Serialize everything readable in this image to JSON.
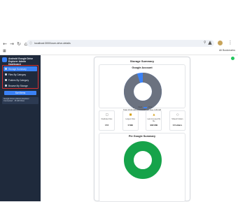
{
  "browser": {
    "url": "localhost:3000/user-drive-details",
    "all_bookmarks": "All Bookmarks",
    "icons": {
      "back": "arrow-left-icon",
      "forward": "arrow-right-icon",
      "reload": "reload-icon",
      "home": "home-icon",
      "site_info": "site-info-icon",
      "bookmark": "star-icon",
      "extensions": "puzzle-icon",
      "menu": "kebab-menu-icon",
      "apps": "apps-grid-icon"
    }
  },
  "sidebar": {
    "brand": "Android Google Drive Explorer Admin Dashboard",
    "items": [
      {
        "label": "Storage Summary",
        "active": true
      },
      {
        "label": "Files By Category",
        "active": false
      },
      {
        "label": "Folders By Category",
        "active": false
      },
      {
        "label": "Browse My Storage",
        "active": false
      }
    ],
    "button": "Sort Items",
    "note": [
      "Google Drive (Admin) Explorer",
      "Connected · 15 GB Drive"
    ]
  },
  "card": {
    "title": "Storage Summary",
    "account": {
      "title": "Google Account",
      "legend": [
        "Used",
        "Free"
      ],
      "totals": "Total: 15.00 GB  Used: 14.20 GB  Free: 0.80 GB",
      "used_fraction": 0.95,
      "colors": {
        "used": "#6b7280",
        "free": "#3b82f6"
      }
    },
    "stats": [
      {
        "icon": "file-icon",
        "label": "Duplicate Files",
        "value": "173"
      },
      {
        "icon": "folder-icon",
        "label": "Largest Files",
        "value": "0 MB"
      },
      {
        "icon": "lock-icon",
        "label": "Last Accessed By Me",
        "value": "982 MB"
      },
      {
        "icon": "share-icon",
        "label": "Shared Folders",
        "value": "0 Folders"
      }
    ],
    "storage_summary": {
      "title": "Pie Google Summary",
      "color": "#16a34a",
      "used_fraction": 1.0
    }
  }
}
